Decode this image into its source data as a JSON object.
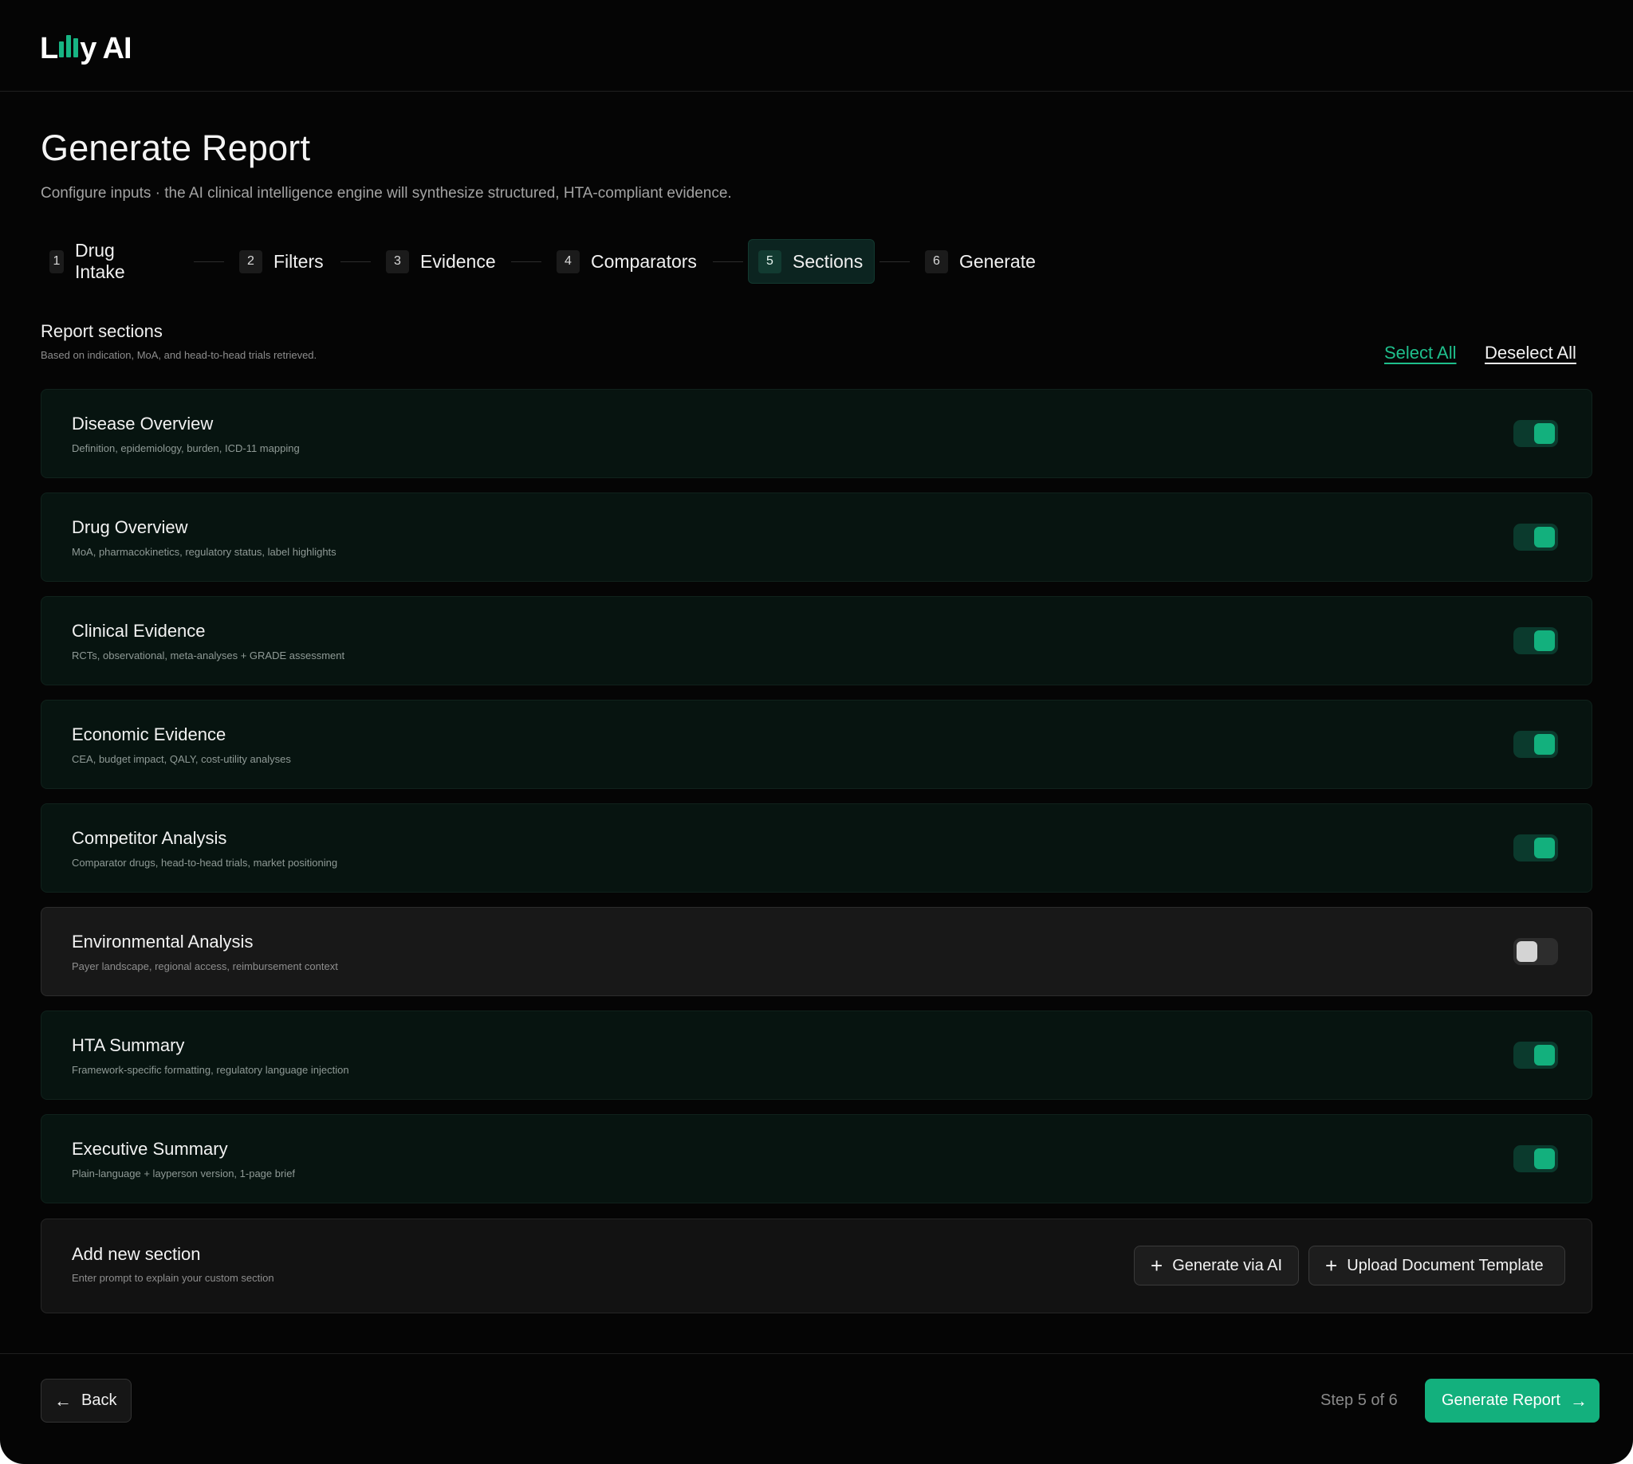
{
  "brand": {
    "logo_text_a": "L",
    "logo_text_b": "y AI",
    "logo_name": "Lilly AI",
    "accent": "#13b07d"
  },
  "page": {
    "title": "Generate Report",
    "subtitle": "Configure inputs · the AI clinical intelligence engine will synthesize structured, HTA-compliant evidence."
  },
  "stepper": {
    "active_step": 5,
    "steps": [
      {
        "num": "1",
        "label": "Drug Intake"
      },
      {
        "num": "2",
        "label": "Filters"
      },
      {
        "num": "3",
        "label": "Evidence"
      },
      {
        "num": "4",
        "label": "Comparators"
      },
      {
        "num": "5",
        "label": "Sections"
      },
      {
        "num": "6",
        "label": "Generate"
      }
    ]
  },
  "sections_header": {
    "title": "Report sections",
    "subtitle": "Based on indication, MoA, and head-to-head trials retrieved.",
    "select_all": "Select All",
    "deselect_all": "Deselect All"
  },
  "sections": [
    {
      "title": "Disease Overview",
      "desc": "Definition, epidemiology, burden, ICD-11 mapping",
      "enabled": true
    },
    {
      "title": "Drug Overview",
      "desc": "MoA, pharmacokinetics, regulatory status, label highlights",
      "enabled": true
    },
    {
      "title": "Clinical Evidence",
      "desc": "RCTs, observational, meta-analyses + GRADE assessment",
      "enabled": true
    },
    {
      "title": "Economic Evidence",
      "desc": "CEA, budget impact, QALY, cost-utility analyses",
      "enabled": true
    },
    {
      "title": "Competitor Analysis",
      "desc": "Comparator drugs, head-to-head trials, market positioning",
      "enabled": true
    },
    {
      "title": "Environmental Analysis",
      "desc": "Payer landscape, regional access, reimbursement context",
      "enabled": false
    },
    {
      "title": "HTA Summary",
      "desc": "Framework-specific formatting, regulatory language injection",
      "enabled": true
    },
    {
      "title": "Executive Summary",
      "desc": "Plain-language + layperson version, 1-page brief",
      "enabled": true
    }
  ],
  "add_section": {
    "title": "Add new section",
    "desc": "Enter prompt to explain your custom section",
    "generate_label": "Generate via AI",
    "upload_label": "Upload Document Template"
  },
  "footer": {
    "back_label": "Back",
    "step_info": "Step 5 of 6",
    "generate_label": "Generate Report"
  }
}
